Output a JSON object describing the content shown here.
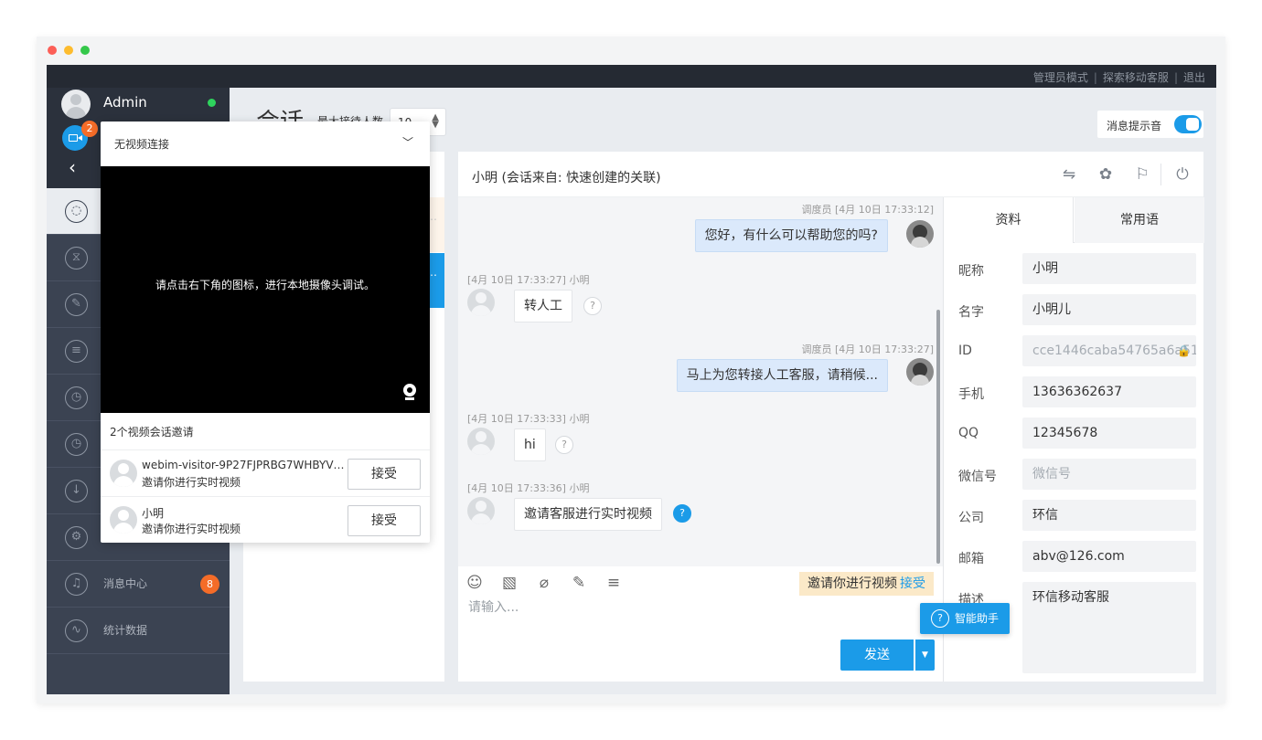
{
  "top_links": {
    "admin_mode": "管理员模式",
    "explore_mobile": "探索移动客服",
    "logout": "退出"
  },
  "user": {
    "name": "Admin",
    "status_color": "#2ed35d"
  },
  "video_badge": "2",
  "nav": [
    {
      "name": "nav-sessions",
      "icon": "chat-bubble-icon",
      "label": ""
    },
    {
      "name": "nav-waiting",
      "icon": "hourglass-icon",
      "label": ""
    },
    {
      "name": "nav-notes",
      "icon": "edit-icon",
      "label": ""
    },
    {
      "name": "nav-records",
      "icon": "document-icon",
      "label": ""
    },
    {
      "name": "nav-history",
      "icon": "clock-icon",
      "label": ""
    },
    {
      "name": "nav-monitor",
      "icon": "clock-icon",
      "label": ""
    },
    {
      "name": "nav-download",
      "icon": "download-icon",
      "label": ""
    },
    {
      "name": "nav-settings",
      "icon": "gear-icon",
      "label": ""
    },
    {
      "name": "nav-messages",
      "icon": "bell-icon",
      "label": "消息中心",
      "badge": "8"
    },
    {
      "name": "nav-stats",
      "icon": "chart-icon",
      "label": "统计数据"
    }
  ],
  "main": {
    "title": "会话",
    "max_label": "最大接待人数",
    "max_value": "10",
    "sound_label": "消息提示音"
  },
  "chat": {
    "title": "小明 (会话来自: 快速创建的关联)",
    "messages": [
      {
        "meta": "调度员 [4月 10日 17:33:12]",
        "text": "您好，有什么可以帮助您的吗?",
        "from": "agent"
      },
      {
        "meta": "[4月 10日 17:33:27] 小明",
        "text": "转人工",
        "from": "visitor"
      },
      {
        "meta": "调度员 [4月 10日 17:33:27]",
        "text": "马上为您转接人工客服，请稍候...",
        "from": "agent"
      },
      {
        "meta": "[4月 10日 17:33:33] 小明",
        "text": "hi",
        "from": "visitor"
      },
      {
        "meta": "[4月 10日 17:33:36] 小明",
        "text": "邀请客服进行实时视频",
        "from": "visitor"
      }
    ],
    "invite_tag": "邀请你进行视频",
    "invite_accept": "接受",
    "input_placeholder": "请输入...",
    "send": "发送"
  },
  "info": {
    "tab_profile": "资料",
    "tab_phrases": "常用语",
    "fields": [
      {
        "label": "昵称",
        "value": "小明"
      },
      {
        "label": "名字",
        "value": "小明儿"
      },
      {
        "label": "ID",
        "value": "cce1446caba54765a6a51"
      },
      {
        "label": "手机",
        "value": "13636362637"
      },
      {
        "label": "QQ",
        "value": "12345678"
      },
      {
        "label": "微信号",
        "value": "",
        "placeholder": "微信号"
      },
      {
        "label": "公司",
        "value": "环信"
      },
      {
        "label": "邮箱",
        "value": "abv@126.com"
      },
      {
        "label": "描述",
        "value": "环信移动客服"
      }
    ]
  },
  "assistant": "智能助手",
  "video_panel": {
    "select": "无视频连接",
    "hint": "请点击右下角的图标，进行本地摄像头调试。",
    "invites_title": "2个视频会话邀请",
    "invites": [
      {
        "name": "webim-visitor-9P27FJPRBG7WHBYV7...",
        "sub": "邀请你进行实时视频",
        "accept": "接受"
      },
      {
        "name": "小明",
        "sub": "邀请你进行实时视频",
        "accept": "接受"
      }
    ]
  },
  "colors": {
    "accent": "#1b9be8",
    "sidebar": "#3b4352",
    "topbar": "#252a33",
    "badge": "#f46c28"
  }
}
